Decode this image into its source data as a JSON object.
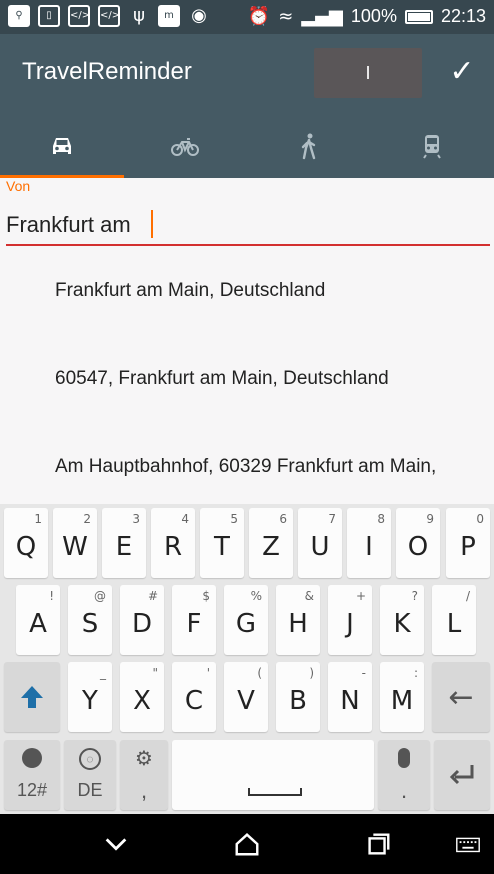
{
  "status_bar": {
    "battery_text": "100%",
    "time": "22:13",
    "notification_icons": [
      "search-icon",
      "phone-outline-icon",
      "code-icon",
      "code-icon",
      "usb-icon",
      "m-icon",
      "android-icon"
    ],
    "m_label": "m"
  },
  "app_bar": {
    "title": "TravelReminder",
    "action_text": "I"
  },
  "tabs": [
    {
      "name": "car-icon",
      "active": true
    },
    {
      "name": "bicycle-icon",
      "active": false
    },
    {
      "name": "walk-icon",
      "active": false
    },
    {
      "name": "train-icon",
      "active": false
    }
  ],
  "form": {
    "from_label": "Von",
    "from_value": "Frankfurt am "
  },
  "suggestions": [
    "Frankfurt am Main, Deutschland",
    "60547, Frankfurt am Main, Deutschland",
    "Am Hauptbahnhof, 60329 Frankfurt am Main,"
  ],
  "keyboard": {
    "row1": [
      {
        "main": "Q",
        "sub": "1"
      },
      {
        "main": "W",
        "sub": "2"
      },
      {
        "main": "E",
        "sub": "3"
      },
      {
        "main": "R",
        "sub": "4"
      },
      {
        "main": "T",
        "sub": "5"
      },
      {
        "main": "Z",
        "sub": "6"
      },
      {
        "main": "U",
        "sub": "7"
      },
      {
        "main": "I",
        "sub": "8"
      },
      {
        "main": "O",
        "sub": "9"
      },
      {
        "main": "P",
        "sub": "0"
      }
    ],
    "row2": [
      {
        "main": "A",
        "sub": "!"
      },
      {
        "main": "S",
        "sub": "@"
      },
      {
        "main": "D",
        "sub": "#"
      },
      {
        "main": "F",
        "sub": "$"
      },
      {
        "main": "G",
        "sub": "%"
      },
      {
        "main": "H",
        "sub": "&"
      },
      {
        "main": "J",
        "sub": "+"
      },
      {
        "main": "K",
        "sub": "?"
      },
      {
        "main": "L",
        "sub": "/"
      }
    ],
    "row3": [
      {
        "main": "Y",
        "sub": "_"
      },
      {
        "main": "X",
        "sub": "\""
      },
      {
        "main": "C",
        "sub": "'"
      },
      {
        "main": "V",
        "sub": "("
      },
      {
        "main": "B",
        "sub": ")"
      },
      {
        "main": "N",
        "sub": "-"
      },
      {
        "main": "M",
        "sub": ":"
      }
    ],
    "symbols_label": "12#",
    "language_label": "DE",
    "comma_label": ",",
    "period_label": "."
  },
  "colors": {
    "app_bar": "#455a64",
    "status_bar": "#37474f",
    "accent": "#ff6f00",
    "input_underline": "#d32f2f",
    "shift_active": "#1e6fa8"
  }
}
